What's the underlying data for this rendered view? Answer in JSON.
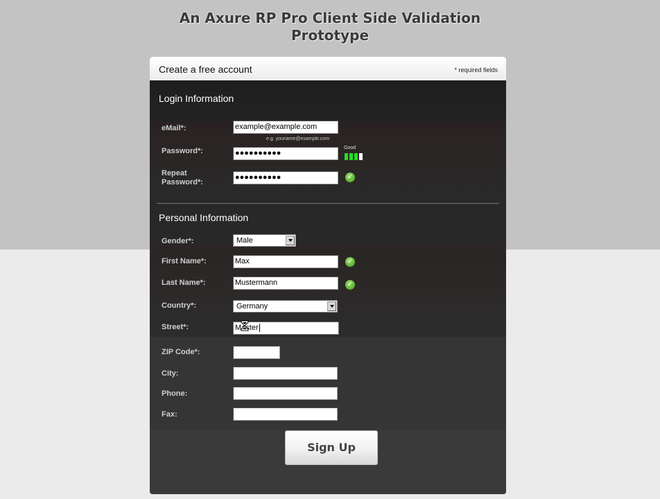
{
  "page": {
    "title_line1": "An Axure RP Pro Client Side Validation",
    "title_line2": "Prototype"
  },
  "form": {
    "header": "Create a free account",
    "required_note": "* required fields",
    "login_section": "Login Information",
    "personal_section": "Personal Information",
    "fields": {
      "email": {
        "label": "eMail*:",
        "value": "example@example.com",
        "hint": "e.g. youname@example.com"
      },
      "password": {
        "label": "Password*:",
        "value": "●●●●●●●●●●",
        "strength_label": "Good",
        "strength_level": 0.75
      },
      "repeat_password": {
        "label_line1": "Repeat",
        "label_line2": "Password*:",
        "value": "●●●●●●●●●●"
      },
      "gender": {
        "label": "Gender*:",
        "value": "Male"
      },
      "first_name": {
        "label": "First Name*:",
        "value": "Max"
      },
      "last_name": {
        "label": "Last Name*:",
        "value": "Mustermann"
      },
      "country": {
        "label": "Country*:",
        "value": "Germany"
      },
      "street": {
        "label": "Street*:",
        "value": "Master"
      },
      "zip": {
        "label": "ZIP Code*:",
        "value": ""
      },
      "city": {
        "label": "City:",
        "value": ""
      },
      "phone": {
        "label": "Phone:",
        "value": ""
      },
      "fax": {
        "label": "Fax:",
        "value": ""
      }
    },
    "submit_label": "Sign Up"
  },
  "colors": {
    "valid_check": "#3f9b1c",
    "strength_filled": "#22dd22",
    "strength_empty": "#ffffff"
  },
  "icons": [
    "valid-check-icon",
    "hourglass-cursor-icon"
  ]
}
